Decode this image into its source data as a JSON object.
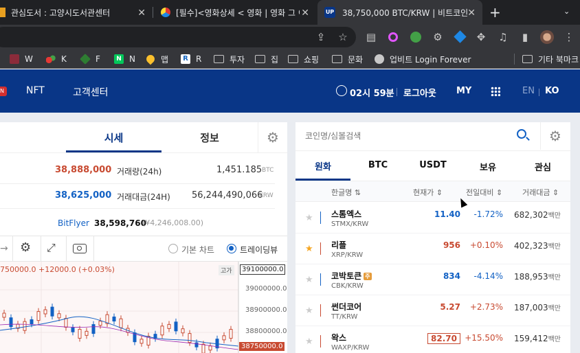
{
  "browser": {
    "tabs": [
      {
        "title": "관심도서 : 고양시도서관센터"
      },
      {
        "title": "[필수]<영화상세 < 영화 | 영화 그 이"
      },
      {
        "title": "38,750,000 BTC/KRW | 비트코인"
      }
    ],
    "new_tab": "+",
    "bookmarks": [
      "W",
      "K",
      "F",
      "N",
      "맵",
      "R",
      "투자",
      "집",
      "쇼핑",
      "문화",
      "업비트 Login Forever",
      "기타 북마크"
    ]
  },
  "site": {
    "nav": [
      "NFT",
      "고객센터"
    ],
    "time": "02시 59분",
    "logout": "로그아웃",
    "my": "MY",
    "lang_en": "EN",
    "lang_ko": "KO",
    "brand_color": "#093687"
  },
  "detail": {
    "tabs": [
      "시세",
      "정보"
    ],
    "high_price": "38,888,000",
    "low_price": "38,625,000",
    "volume_label": "거래량(24h)",
    "volume_value": "1,451.185",
    "volume_unit": "BTC",
    "amount_label": "거래대금(24H)",
    "amount_value": "56,244,490,066",
    "amount_unit": "KRW",
    "exchange_name": "BitFlyer",
    "exchange_price": "38,598,760",
    "exchange_jpy": "(¥4,246,008.00)"
  },
  "chart_toolbar": {
    "basic_chart": "기본 차트",
    "trading_view": "트레이딩뷰"
  },
  "chart": {
    "info": "750000.0 +12000.0 (+0.03%)",
    "high_tag": "고가",
    "high_value": "39100000.0",
    "ticks": [
      "39000000.0",
      "38900000.0",
      "38800000.0"
    ],
    "current": "38750000.0"
  },
  "market": {
    "search_placeholder": "코인명/심볼검색",
    "tabs": [
      "원화",
      "BTC",
      "USDT",
      "보유",
      "관심"
    ],
    "headers": {
      "name": "한글명",
      "price": "현재가",
      "change": "전일대비",
      "volume": "거래대금"
    },
    "volume_unit": "백만",
    "rows": [
      {
        "name": "스톰엑스",
        "symbol": "STMX/KRW",
        "price": "11.40",
        "change": "-1.72%",
        "volume": "682,302",
        "dir": "down",
        "fav": false
      },
      {
        "name": "리플",
        "symbol": "XRP/KRW",
        "price": "956",
        "change": "+0.10%",
        "volume": "402,323",
        "dir": "up",
        "fav": true
      },
      {
        "name": "코박토큰",
        "symbol": "CBK/KRW",
        "price": "834",
        "change": "-4.14%",
        "volume": "188,953",
        "dir": "down",
        "fav": false,
        "badge": "주"
      },
      {
        "name": "썬더코어",
        "symbol": "TT/KRW",
        "price": "5.27",
        "change": "+2.73%",
        "volume": "187,003",
        "dir": "up",
        "fav": false
      },
      {
        "name": "왁스",
        "symbol": "WAXP/KRW",
        "price": "82.70",
        "change": "+15.50%",
        "volume": "159,412",
        "dir": "up",
        "fav": false
      }
    ]
  }
}
